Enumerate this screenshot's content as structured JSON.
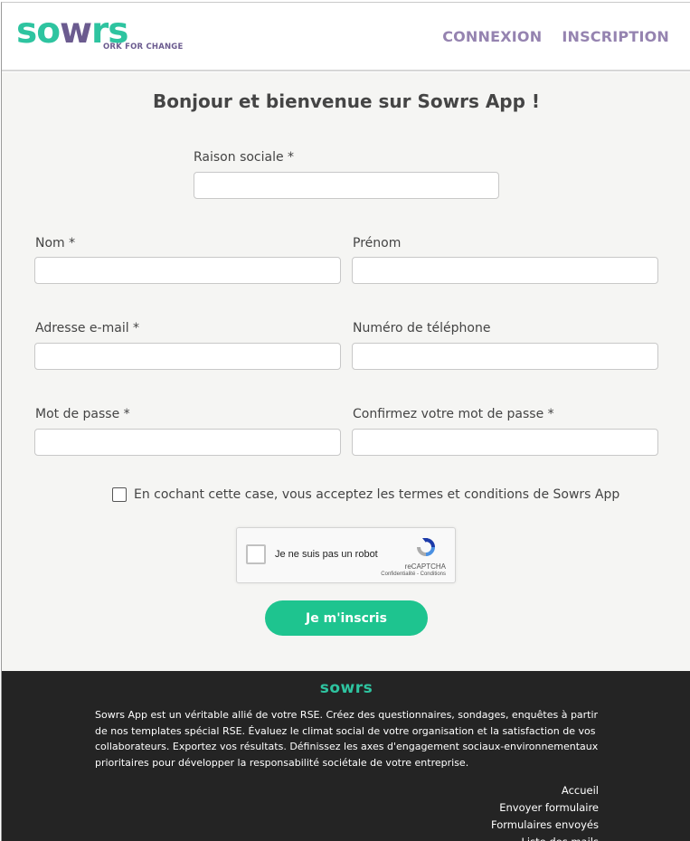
{
  "header": {
    "logo": {
      "part1": "so",
      "part2": "w",
      "part3": "rs",
      "tagline": "ORK FOR CHANGE"
    },
    "nav": {
      "login": "CONNEXION",
      "signup": "INSCRIPTION"
    }
  },
  "form": {
    "title": "Bonjour et bienvenue sur Sowrs App !",
    "company_label": "Raison sociale *",
    "company_value": "",
    "last_name_label": "Nom *",
    "last_name_value": "",
    "first_name_label": "Prénom",
    "first_name_value": "",
    "email_label": "Adresse e-mail *",
    "email_value": "",
    "phone_label": "Numéro de téléphone",
    "phone_value": "",
    "password_label": "Mot de passe *",
    "password_value": "",
    "confirm_label": "Confirmez votre mot de passe *",
    "confirm_value": "",
    "terms_text": "En cochant cette case, vous acceptez les termes et conditions de Sowrs App",
    "terms_checked": false,
    "captcha": {
      "label": "Je ne suis pas un robot",
      "brand": "reCAPTCHA",
      "links": "Confidentialité - Conditions"
    },
    "submit_label": "Je m'inscris"
  },
  "footer": {
    "logo": "sowrs",
    "description": "Sowrs App est un véritable allié de votre RSE. Créez des questionnaires, sondages, enquêtes à partir de nos templates spécial RSE. Évaluez le climat social de votre organisation et la satisfaction de vos collaborateurs. Exportez vos résultats. Définissez les axes d'engagement sociaux-environnementaux prioritaires pour développer la responsabilité sociétale de votre entreprise.",
    "links": [
      "Accueil",
      "Envoyer formulaire",
      "Formulaires envoyés",
      "Liste des mails"
    ]
  },
  "colors": {
    "brand_green": "#2ec4a0",
    "brand_purple": "#6b5b8f",
    "nav_purple": "#9583b0",
    "button_green": "#1ec48f",
    "footer_bg": "#242424",
    "form_bg": "#f5f5f3"
  },
  "icons": [
    "sowrs-logo",
    "checkbox-icon",
    "recaptcha-icon"
  ]
}
